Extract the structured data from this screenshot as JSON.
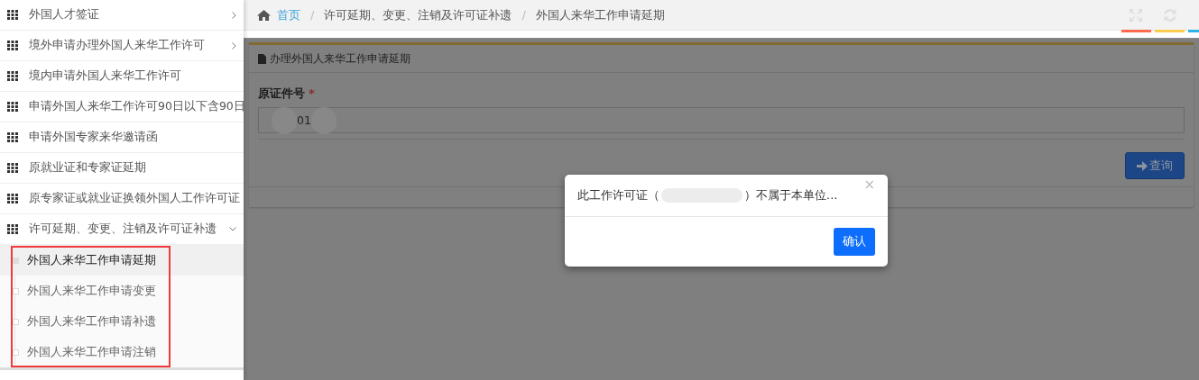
{
  "sidebar": {
    "items": [
      {
        "label": "外国人才签证",
        "kind": "group",
        "expanded": false
      },
      {
        "label": "境外申请办理外国人来华工作许可",
        "kind": "group",
        "expanded": false
      },
      {
        "label": "境内申请外国人来华工作许可",
        "kind": "link"
      },
      {
        "label": "申请外国人来华工作许可90日以下含90日",
        "kind": "link"
      },
      {
        "label": "申请外国专家来华邀请函",
        "kind": "link"
      },
      {
        "label": "原就业证和专家证延期",
        "kind": "link"
      },
      {
        "label": "原专家证或就业证换领外国人工作许可证",
        "kind": "link"
      },
      {
        "label": "许可延期、变更、注销及许可证补遗",
        "kind": "group",
        "expanded": true,
        "children": [
          {
            "label": "外国人来华工作申请延期",
            "selected": true
          },
          {
            "label": "外国人来华工作申请变更",
            "selected": false
          },
          {
            "label": "外国人来华工作申请补遗",
            "selected": false
          },
          {
            "label": "外国人来华工作申请注销",
            "selected": false
          }
        ]
      }
    ]
  },
  "breadcrumb_separator": "/",
  "breadcrumb": [
    {
      "label": "首页",
      "kind": "home"
    },
    {
      "label": "许可延期、变更、注销及许可证补遗",
      "kind": "text"
    },
    {
      "label": "外国人来华工作申请延期",
      "kind": "text"
    }
  ],
  "tab_markers": [
    {
      "color": "#ff6a4d"
    },
    {
      "color": "#ffcc4d"
    },
    {
      "color": "#29b6e6"
    }
  ],
  "panel": {
    "title": "办理外国人来华工作申请延期",
    "field_label": "原证件号",
    "required_mark": "*",
    "field_value": "01",
    "button": "查询"
  },
  "dialog": {
    "message_start": "此工作许可证（",
    "message_end": "）不属于本单位...",
    "close": "×",
    "confirm": "确认"
  }
}
